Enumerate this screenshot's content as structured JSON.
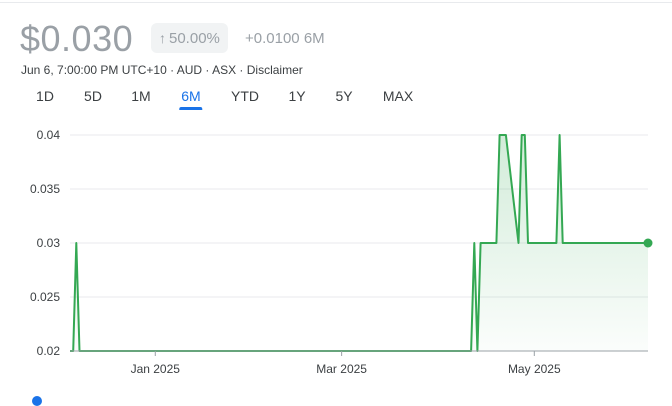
{
  "quote": {
    "price": "$0.030",
    "change_pct": "50.00%",
    "change_abs": "+0.0100",
    "change_period": "6M",
    "meta": "Jun 6, 7:00:00 PM UTC+10 · AUD · ASX · Disclaimer"
  },
  "ranges": [
    {
      "label": "1D"
    },
    {
      "label": "5D"
    },
    {
      "label": "1M"
    },
    {
      "label": "6M"
    },
    {
      "label": "YTD"
    },
    {
      "label": "1Y"
    },
    {
      "label": "5Y"
    },
    {
      "label": "MAX"
    }
  ],
  "active_range": "6M",
  "colors": {
    "line": "#34a853",
    "accent": "#1a73e8",
    "grid": "#e8eaed",
    "muted": "#9aa0a6"
  },
  "chart_data": {
    "type": "area",
    "ylim": [
      0.02,
      0.04
    ],
    "ytick_labels": [
      "0.04",
      "0.035",
      "0.03",
      "0.025",
      "0.02"
    ],
    "ytick_values": [
      0.04,
      0.035,
      0.03,
      0.025,
      0.02
    ],
    "xlim": [
      "2024-12-05",
      "2025-06-06"
    ],
    "xtick_labels": [
      "Jan 2025",
      "Mar 2025",
      "May 2025"
    ],
    "xtick_values": [
      "2025-01-01",
      "2025-03-01",
      "2025-05-01"
    ],
    "grid": true,
    "series": [
      {
        "x": [
          "2024-12-05",
          "2024-12-06",
          "2024-12-07",
          "2024-12-08",
          "2024-12-09",
          "2025-04-11",
          "2025-04-12",
          "2025-04-13",
          "2025-04-14",
          "2025-04-15",
          "2025-04-19",
          "2025-04-20",
          "2025-04-21",
          "2025-04-22",
          "2025-04-26",
          "2025-04-27",
          "2025-04-28",
          "2025-04-29",
          "2025-04-30",
          "2025-05-01",
          "2025-05-02",
          "2025-05-08",
          "2025-05-09",
          "2025-05-10",
          "2025-05-11",
          "2025-06-06"
        ],
        "values": [
          0.02,
          0.02,
          0.03,
          0.02,
          0.02,
          0.02,
          0.03,
          0.02,
          0.03,
          0.03,
          0.03,
          0.04,
          0.04,
          0.04,
          0.03,
          0.04,
          0.04,
          0.03,
          0.03,
          0.03,
          0.03,
          0.03,
          0.04,
          0.03,
          0.03,
          0.03
        ]
      }
    ]
  }
}
